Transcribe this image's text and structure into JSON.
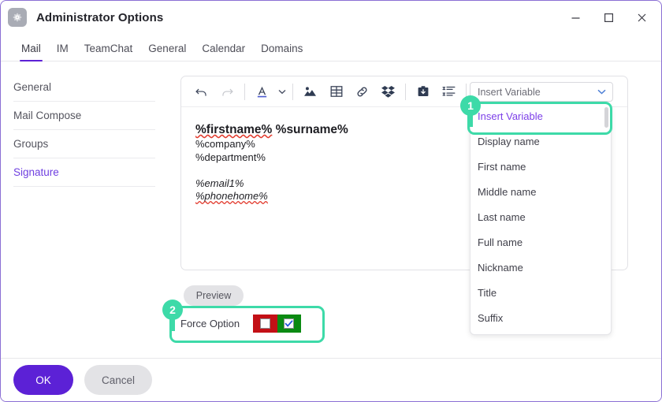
{
  "window": {
    "title": "Administrator Options",
    "app_icon": "gear-icon",
    "controls": {
      "minimize": "minimize-icon",
      "maximize": "maximize-icon",
      "close": "close-icon"
    }
  },
  "tabs": [
    {
      "label": "Mail",
      "active": true
    },
    {
      "label": "IM",
      "active": false
    },
    {
      "label": "TeamChat",
      "active": false
    },
    {
      "label": "General",
      "active": false
    },
    {
      "label": "Calendar",
      "active": false
    },
    {
      "label": "Domains",
      "active": false
    }
  ],
  "sidebar": {
    "items": [
      {
        "label": "General",
        "active": false
      },
      {
        "label": "Mail Compose",
        "active": false
      },
      {
        "label": "Groups",
        "active": false
      },
      {
        "label": "Signature",
        "active": true
      }
    ]
  },
  "editor": {
    "toolbar": [
      {
        "name": "undo-icon",
        "disabled": false
      },
      {
        "name": "redo-icon",
        "disabled": true
      },
      {
        "name": "font-color-icon",
        "disabled": false
      },
      {
        "name": "chevron-down-icon",
        "disabled": false
      },
      {
        "name": "insert-image-icon",
        "disabled": false
      },
      {
        "name": "insert-table-icon",
        "disabled": false
      },
      {
        "name": "insert-link-icon",
        "disabled": false
      },
      {
        "name": "dropbox-icon",
        "disabled": false
      },
      {
        "name": "attach-icon",
        "disabled": false
      },
      {
        "name": "align-list-icon",
        "disabled": false
      },
      {
        "name": "spellcheck-icon",
        "disabled": false
      }
    ],
    "signature_lines": [
      {
        "text": "%firstname% %surname%",
        "style": "bold",
        "misspelled": "%firstname%"
      },
      {
        "text": "%company%",
        "style": "normal"
      },
      {
        "text": "%department%",
        "style": "normal"
      },
      {
        "text": "",
        "style": "normal"
      },
      {
        "text": "%email1%",
        "style": "italic"
      },
      {
        "text": "%phonehome%",
        "style": "italic-misspelled"
      }
    ]
  },
  "variable_select": {
    "value": "Insert Variable",
    "chevron": "chevron-down-icon",
    "options": [
      {
        "label": "Insert Variable",
        "selected": true
      },
      {
        "label": "Display name",
        "selected": false
      },
      {
        "label": "First name",
        "selected": false
      },
      {
        "label": "Middle name",
        "selected": false
      },
      {
        "label": "Last name",
        "selected": false
      },
      {
        "label": "Full name",
        "selected": false
      },
      {
        "label": "Nickname",
        "selected": false
      },
      {
        "label": "Title",
        "selected": false
      },
      {
        "label": "Suffix",
        "selected": false
      }
    ]
  },
  "preview": {
    "label": "Preview"
  },
  "force_option": {
    "label": "Force Option",
    "off_checked": false,
    "on_checked": true,
    "off_color": "#c31016",
    "on_color": "#0b8a12"
  },
  "annotations": [
    {
      "number": "1",
      "target": "insert-variable-option"
    },
    {
      "number": "2",
      "target": "force-option-row"
    }
  ],
  "footer": {
    "ok_label": "OK",
    "cancel_label": "Cancel",
    "ok_color": "#5c21d6"
  }
}
